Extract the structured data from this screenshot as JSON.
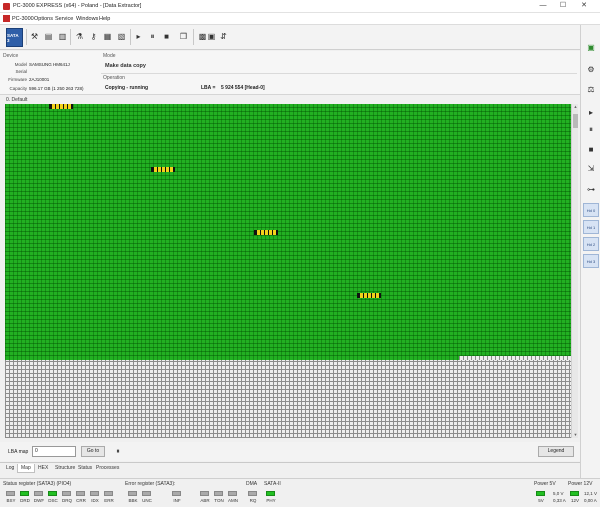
{
  "window": {
    "title": "PC-3000 EXPRESS (x64) - Poland - [Data Extractor]",
    "minimize_glyph": "—",
    "maximize_glyph": "☐",
    "close_glyph": "✕"
  },
  "menu": {
    "items": [
      "PC-3000",
      "Options",
      "Service",
      "Windows",
      "Help"
    ]
  },
  "toolbar": {
    "sata_label": "SATA 3",
    "glyphs": [
      "⚒",
      "▤",
      "▥",
      "⚗",
      "⚷",
      "▦",
      "▧",
      "❒",
      "▸",
      "⏸",
      "■",
      "▩",
      "▣",
      "⇵"
    ]
  },
  "device": {
    "caption": "Device",
    "fields": [
      {
        "key": "Model",
        "value": "SAMSUNG HM641J"
      },
      {
        "key": "Serial",
        "value": ""
      },
      {
        "key": "Firmware",
        "value": "2AJ10001"
      },
      {
        "key": "Capacity",
        "value": "596.17 GB (1 250 263 728)"
      }
    ]
  },
  "mode": {
    "caption": "Mode",
    "value": "Make data copy",
    "operation_caption": "Operation",
    "operation_value": "Copying - running",
    "lba_label": "LBA =",
    "lba_value": "5 924 554  [Head-0]"
  },
  "map": {
    "title": "0. Default",
    "active_block_count": 4
  },
  "bottom": {
    "lba_map_label": "LBA map",
    "lba_value": "0",
    "goto_label": "Go to",
    "pause_glyph": "⏸",
    "legend_label": "Legend"
  },
  "tabs": {
    "items": [
      "Log",
      "Map",
      "HEX",
      "Structure",
      "Status",
      "Processes"
    ],
    "active": "Map"
  },
  "status": {
    "sata_register_title": "Status register (SATA3) (PIO4)",
    "sata_leds": [
      {
        "label": "BSY",
        "on": false
      },
      {
        "label": "DRD",
        "on": true
      },
      {
        "label": "DWF",
        "on": false
      },
      {
        "label": "DSC",
        "on": true
      },
      {
        "label": "DRQ",
        "on": false
      },
      {
        "label": "CRR",
        "on": false
      },
      {
        "label": "IDX",
        "on": false
      },
      {
        "label": "ERR",
        "on": false
      }
    ],
    "error_register_title": "Error register (SATA3):",
    "error_leds": [
      {
        "label": "BBK",
        "on": false
      },
      {
        "label": "UNC",
        "on": false
      },
      {
        "label": "INF",
        "on": false
      },
      {
        "label": "ABR",
        "on": false
      },
      {
        "label": "TON",
        "on": false
      },
      {
        "label": "AMN",
        "on": false
      }
    ],
    "dma_title": "DMA",
    "dma_leds": [
      {
        "label": "RQ",
        "on": false
      }
    ],
    "sata2_title": "SATA-II",
    "sata2_leds": [
      {
        "label": "PHY",
        "on": true
      }
    ],
    "power5_title": "Power 5V",
    "power5_label": "5V",
    "power5_volt": "5,0 V",
    "power5_amp": "0,33 A",
    "power12_title": "Power 12V",
    "power12_label": "12V",
    "power12_volt": "12,1 V",
    "power12_amp": "0,00 A"
  },
  "right_toolbar": {
    "blue_labels": [
      "Hd 0",
      "Hd 1",
      "Hd 2",
      "Hd 3"
    ]
  }
}
